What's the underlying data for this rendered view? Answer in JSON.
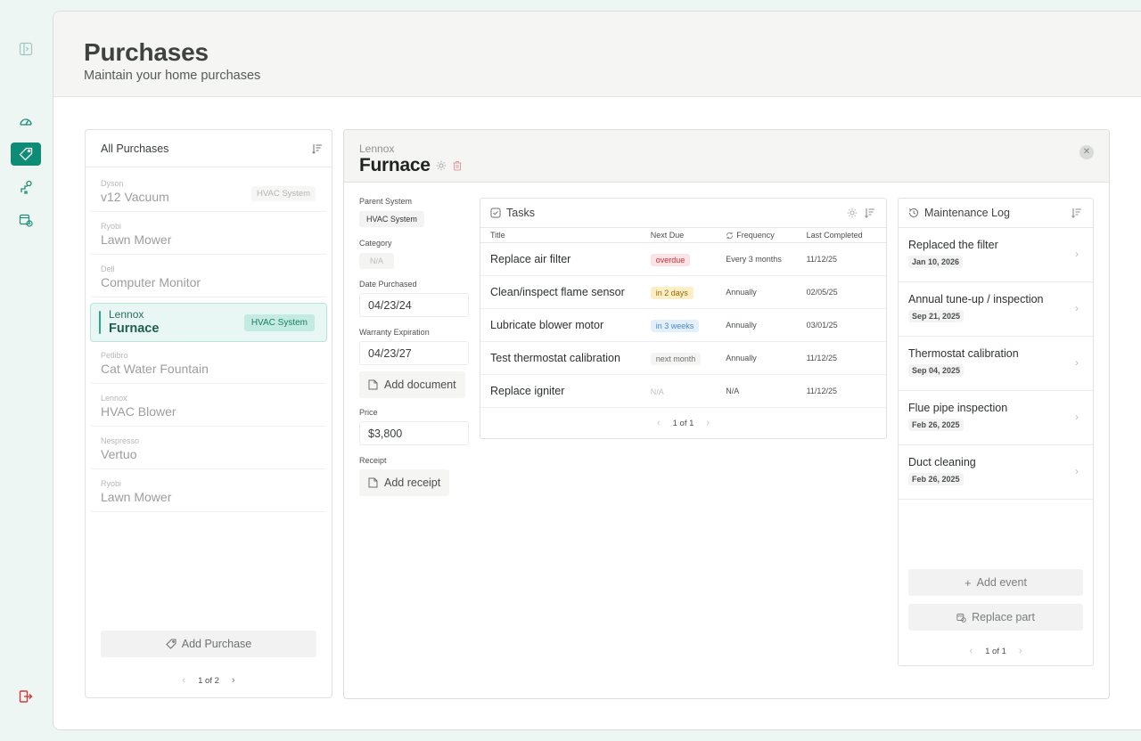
{
  "page": {
    "title": "Purchases",
    "subtitle": "Maintain your home purchases"
  },
  "colors": {
    "accent": "#0e8c75",
    "danger": "#c8323d",
    "active_bg": "#e8f7f3"
  },
  "rail": {
    "icons": [
      "sidebar-toggle-icon",
      "dashboard-gauge-icon",
      "tag-icon",
      "pipe-wrench-icon",
      "calendar-clock-icon",
      "logout-icon"
    ],
    "active": "tag-icon"
  },
  "list": {
    "title": "All Purchases",
    "items": [
      {
        "brand": "Dyson",
        "name": "v12 Vacuum",
        "badge": "HVAC System"
      },
      {
        "brand": "Ryobi",
        "name": "Lawn Mower",
        "badge": ""
      },
      {
        "brand": "Dell",
        "name": "Computer Monitor",
        "badge": ""
      },
      {
        "brand": "Lennox",
        "name": "Furnace",
        "badge": "HVAC System"
      },
      {
        "brand": "Petlibro",
        "name": "Cat Water Fountain",
        "badge": ""
      },
      {
        "brand": "Lennox",
        "name": "HVAC Blower",
        "badge": ""
      },
      {
        "brand": "Nespresso",
        "name": "Vertuo",
        "badge": ""
      },
      {
        "brand": "Ryobi",
        "name": "Lawn Mower",
        "badge": ""
      }
    ],
    "active_index": 3,
    "add_label": "Add Purchase",
    "pager": "1 of 2"
  },
  "detail": {
    "brand": "Lennox",
    "title": "Furnace",
    "parent_system_label": "Parent System",
    "parent_system": "HVAC System",
    "category_label": "Category",
    "category": "N/A",
    "date_purchased_label": "Date Purchased",
    "date_purchased": "04/23/24",
    "warranty_label": "Warranty Expiration",
    "warranty": "04/23/27",
    "add_document": "Add document",
    "price_label": "Price",
    "price": "$3,800",
    "receipt_label": "Receipt",
    "add_receipt": "Add receipt"
  },
  "tasks": {
    "title": "Tasks",
    "columns": [
      "Title",
      "Next Due",
      "Frequency",
      "Last Completed"
    ],
    "rows": [
      {
        "title": "Replace air filter",
        "next_due": "overdue",
        "due_style": "red",
        "frequency": "Every 3 months",
        "last": "11/12/25"
      },
      {
        "title": "Clean/inspect flame sensor",
        "next_due": "in 2 days",
        "due_style": "yellow",
        "frequency": "Annually",
        "last": "02/05/25"
      },
      {
        "title": "Lubricate blower motor",
        "next_due": "in 3 weeks",
        "due_style": "blue",
        "frequency": "Annually",
        "last": "03/01/25"
      },
      {
        "title": "Test thermostat calibration",
        "next_due": "next month",
        "due_style": "gray",
        "frequency": "Annually",
        "last": "11/12/25"
      },
      {
        "title": "Replace igniter",
        "next_due": "N/A",
        "due_style": "na",
        "frequency": "N/A",
        "last": "11/12/25"
      }
    ],
    "pager": "1 of 1"
  },
  "maintenance": {
    "title": "Maintenance Log",
    "items": [
      {
        "title": "Replaced the filter",
        "date": "Jan 10, 2026"
      },
      {
        "title": "Annual tune-up / inspection",
        "date": "Sep 21, 2025"
      },
      {
        "title": "Thermostat calibration",
        "date": "Sep 04, 2025"
      },
      {
        "title": "Flue pipe inspection",
        "date": "Feb 26, 2025"
      },
      {
        "title": "Duct cleaning",
        "date": "Feb 26, 2025"
      }
    ],
    "add_event": "Add event",
    "replace_part": "Replace part",
    "pager": "1 of 1"
  }
}
